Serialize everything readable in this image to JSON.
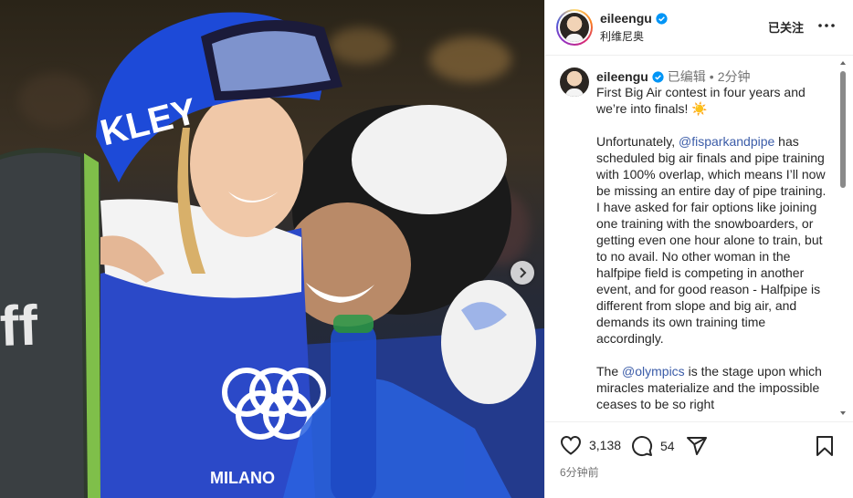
{
  "post": {
    "image_alt": "",
    "next_icon": "chevron-right-icon"
  },
  "header": {
    "username": "eileengu",
    "location": "利维尼奥",
    "follow_label": "已关注",
    "more_icon": "more-horizontal-icon",
    "verified_color": "#0095f6"
  },
  "caption": {
    "username": "eileengu",
    "edited_label": "已编辑",
    "separator": "•",
    "time": "2分钟",
    "text_1": "First Big Air contest in four years and we’re into finals! ☀️",
    "text_2a": "Unfortunately, ",
    "mention_1": "@fisparkandpipe",
    "text_2b": " has scheduled big air finals and pipe training with 100% overlap, which means I’ll now be missing an entire day of pipe training. I have asked for fair options like joining one training with the snowboarders, or getting even one hour alone to train, but to no avail. No other woman in the halfpipe field is competing in another event, and for good reason - Halfpipe is different from slope and big air, and demands its own training time accordingly.",
    "text_3a": "The ",
    "mention_2": "@olympics",
    "text_3b": " is the stage upon which miracles materialize and the impossible ceases to be so right"
  },
  "actions": {
    "like_icon": "heart-icon",
    "like_count": "3,138",
    "comment_icon": "comment-icon",
    "comment_count": "54",
    "share_icon": "send-icon",
    "save_icon": "bookmark-icon",
    "time_ago": "6分钟前"
  },
  "colors": {
    "mention": "#3b5ca8",
    "muted": "#737373",
    "border": "#efefef"
  }
}
